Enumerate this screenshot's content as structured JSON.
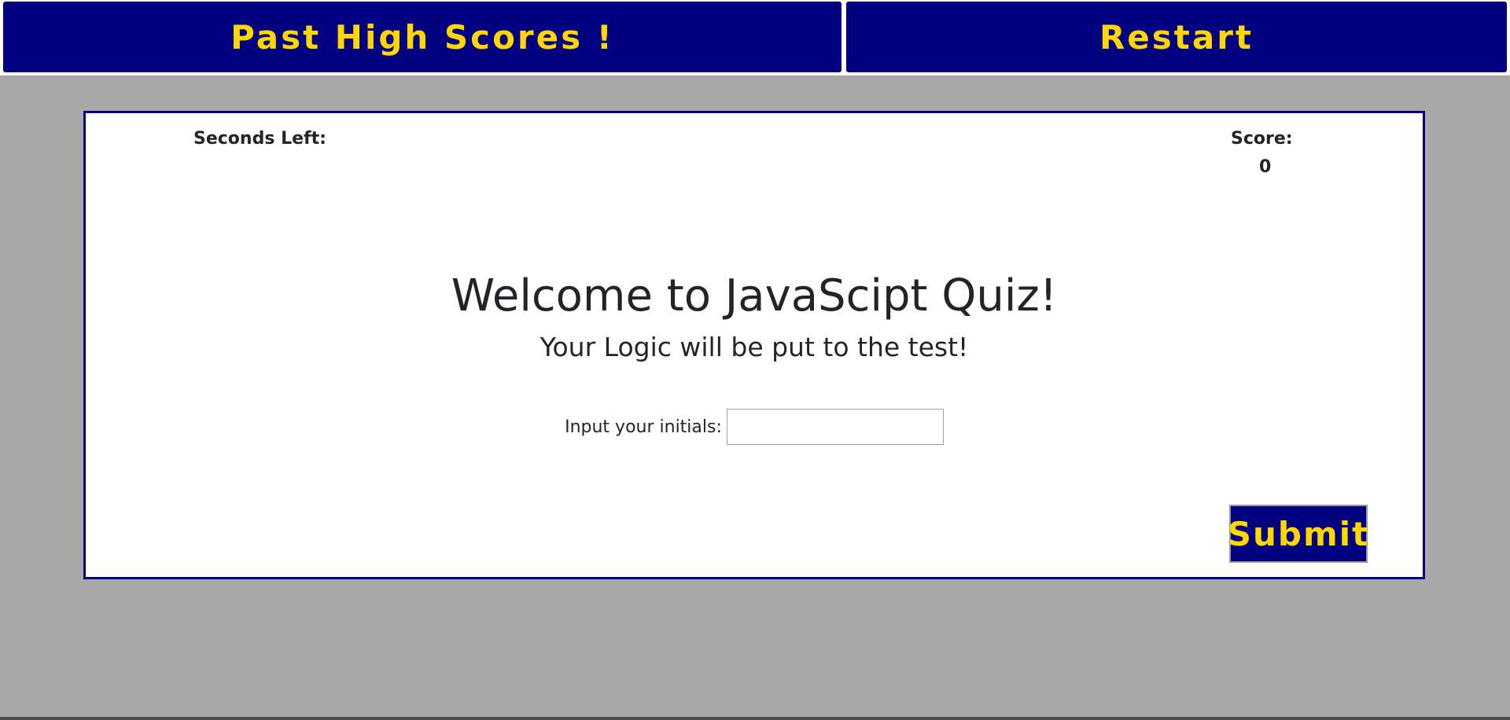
{
  "nav": {
    "high_scores_label": "Past High Scores !",
    "restart_label": "Restart"
  },
  "stats": {
    "seconds_left_label": "Seconds Left:",
    "score_label": "Score:",
    "score_value": "0"
  },
  "intro": {
    "title": "Welcome to JavaScipt Quiz!",
    "subtitle": "Your Logic will be put to the test!"
  },
  "form": {
    "initials_label": "Input your initials:",
    "initials_value": "",
    "submit_label": "Submit"
  },
  "colors": {
    "background": "#a9a9a9",
    "accent": "#000080",
    "button_text": "#ffd700",
    "panel": "#ffffff"
  }
}
